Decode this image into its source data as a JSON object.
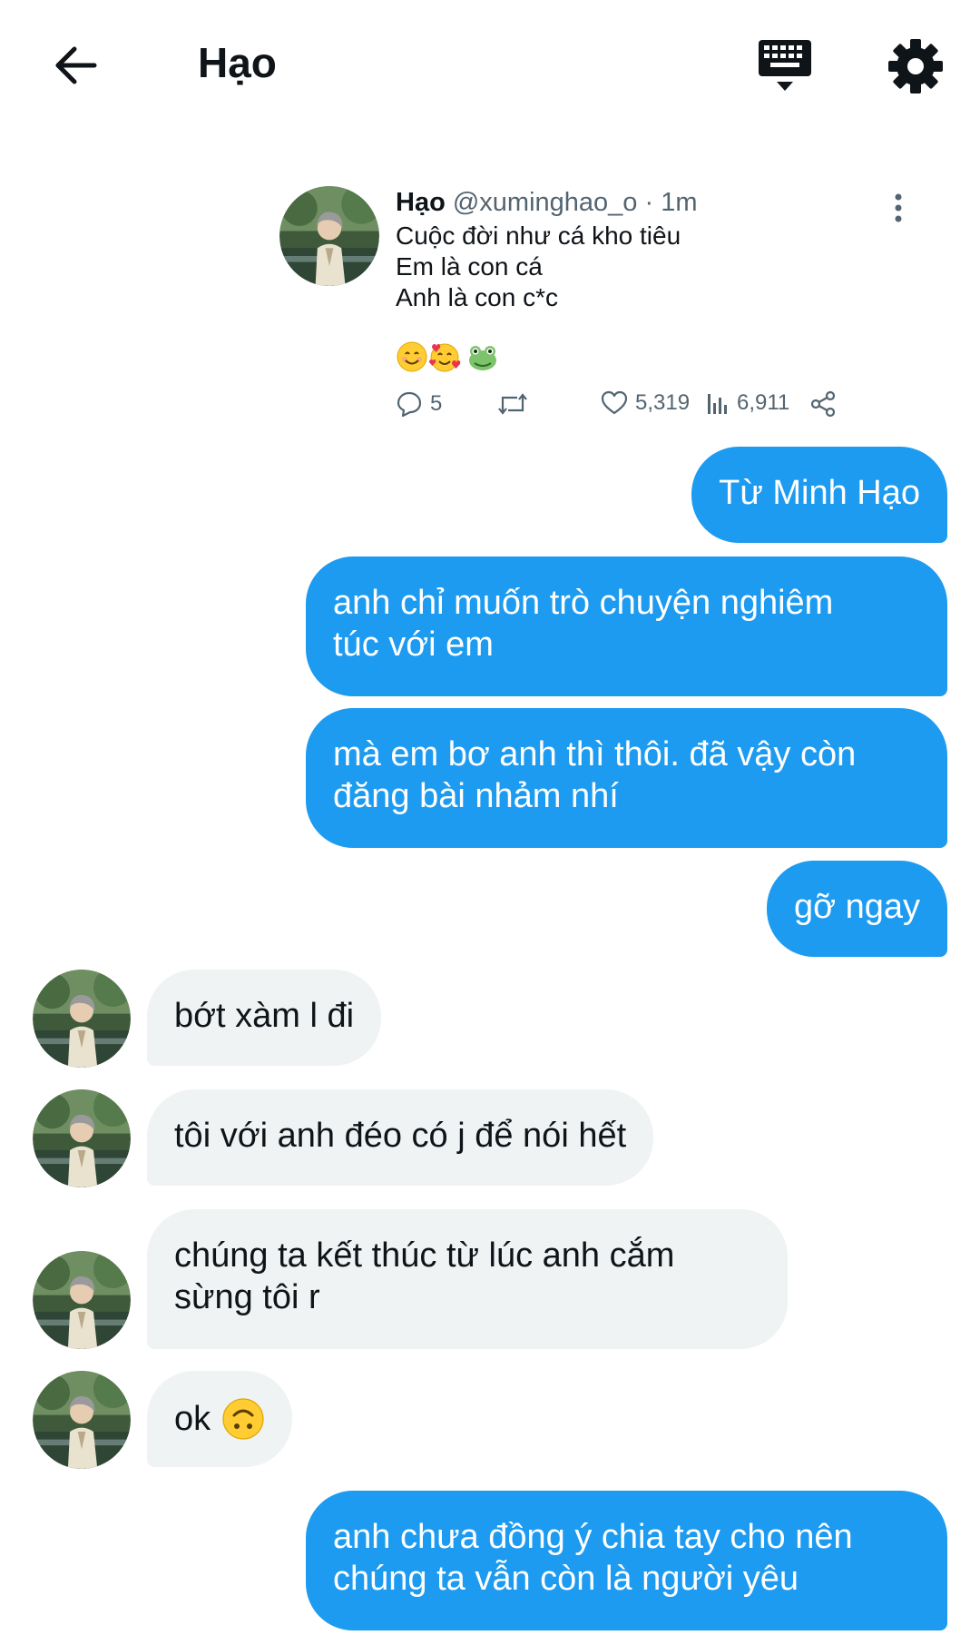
{
  "header": {
    "title": "Hạo",
    "back_icon": "arrow-left-icon",
    "keyboard_icon": "keyboard-icon",
    "settings_icon": "gear-icon"
  },
  "tweet": {
    "name": "Hạo",
    "handle": "@xuminghao_o",
    "separator": " · ",
    "time": "1m",
    "text": "Cuộc đời như cá kho tiêu\nEm là con cá\nAnh là con c*c",
    "emojis": [
      "smiling-face",
      "smiling-face-with-hearts",
      "frog-face"
    ],
    "replies": "5",
    "likes": "5,319",
    "views": "6,911"
  },
  "messages": [
    {
      "id": "m1",
      "direction": "out",
      "text": "Từ Minh Hạo"
    },
    {
      "id": "m2",
      "direction": "out",
      "text": "anh chỉ muốn trò chuyện nghiêm\ntúc với em"
    },
    {
      "id": "m3",
      "direction": "out",
      "text": "mà em bơ anh thì thôi. đã vậy còn\nđăng bài nhảm nhí"
    },
    {
      "id": "m4",
      "direction": "out",
      "text": "gỡ ngay"
    },
    {
      "id": "m5",
      "direction": "in",
      "text": "bớt xàm l đi"
    },
    {
      "id": "m6",
      "direction": "in",
      "text": "tôi với anh đéo có j để nói hết"
    },
    {
      "id": "m7",
      "direction": "in",
      "text": "chúng ta kết thúc từ lúc anh cắm\nsừng tôi r"
    },
    {
      "id": "m8",
      "direction": "in",
      "text": "ok",
      "emoji": "upside-down-face"
    },
    {
      "id": "m9",
      "direction": "out",
      "text": "anh chưa đồng ý chia tay cho nên\nchúng ta vẫn còn là người yêu"
    }
  ],
  "colors": {
    "outgoing_bubble": "#1d9bf0",
    "incoming_bubble": "#eff3f4",
    "text_primary": "#0f1419",
    "text_secondary": "#536471"
  }
}
